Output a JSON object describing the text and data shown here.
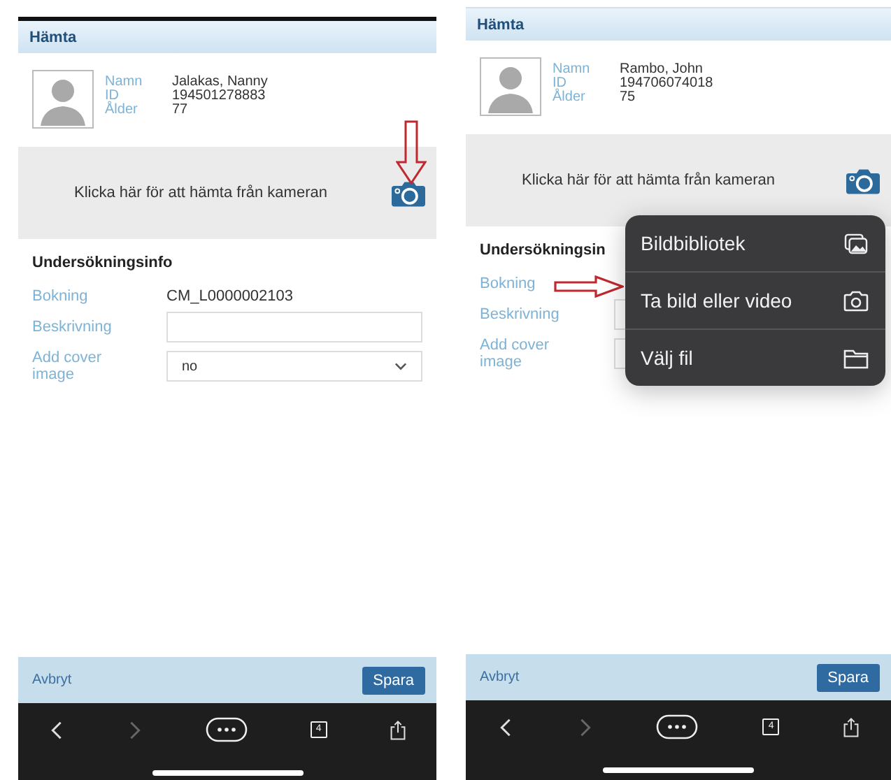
{
  "screens": [
    {
      "header": {
        "title": "Hämta"
      },
      "patient": {
        "fields": [
          {
            "label": "Namn",
            "value": "Jalakas, Nanny"
          },
          {
            "label": "ID",
            "value": "194501278883"
          },
          {
            "label": "Ålder",
            "value": "77"
          }
        ]
      },
      "camera_prompt": "Klicka här för att hämta från kameran",
      "section_title": "Undersökningsinfo",
      "form": [
        {
          "kind": "text",
          "label": "Bokning",
          "value": "CM_L0000002103"
        },
        {
          "kind": "input",
          "label": "Beskrivning"
        },
        {
          "kind": "select",
          "label": "Add cover image",
          "value": "no"
        }
      ],
      "footer": {
        "cancel": "Avbryt",
        "save": "Spara"
      },
      "toolbar": {
        "tab_count": "4"
      },
      "annotation": {
        "kind": "down-arrow"
      }
    },
    {
      "header": {
        "title": "Hämta"
      },
      "patient": {
        "fields": [
          {
            "label": "Namn",
            "value": "Rambo, John"
          },
          {
            "label": "ID",
            "value": "194706074018"
          },
          {
            "label": "Ålder",
            "value": "75"
          }
        ]
      },
      "camera_prompt": "Klicka här för att hämta från kameran",
      "section_title": "Undersökningsin",
      "form": [
        {
          "kind": "text",
          "label": "Bokning"
        },
        {
          "kind": "input",
          "label": "Beskrivning"
        },
        {
          "kind": "select",
          "label": "Add cover image"
        }
      ],
      "footer": {
        "cancel": "Avbryt",
        "save": "Spara"
      },
      "toolbar": {
        "tab_count": "4"
      },
      "annotation": {
        "kind": "right-arrow"
      },
      "menu": [
        {
          "kind": "gallery",
          "label": "Bildbibliotek"
        },
        {
          "kind": "camera",
          "label": "Ta bild eller video"
        },
        {
          "kind": "folder",
          "label": "Välj fil"
        }
      ]
    }
  ]
}
